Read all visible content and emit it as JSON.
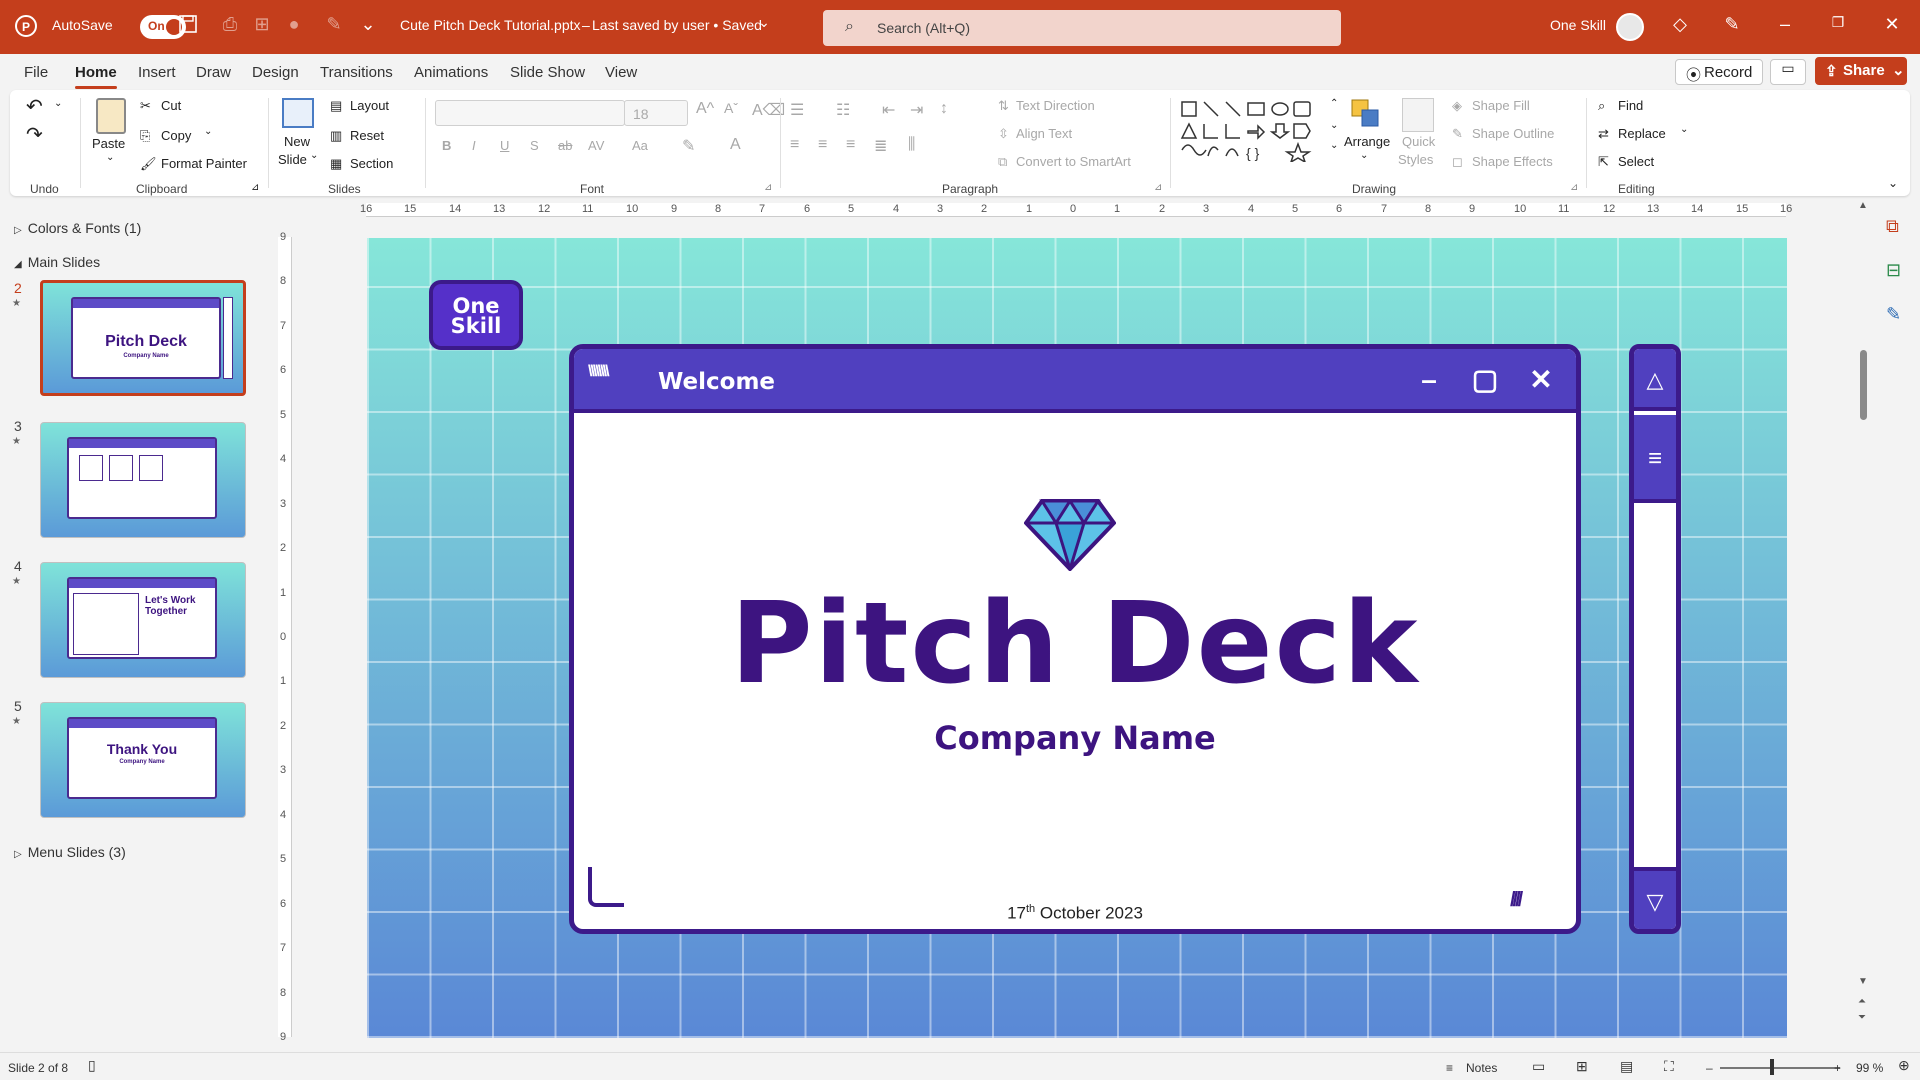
{
  "titlebar": {
    "autosave_label": "AutoSave",
    "autosave_state": "On",
    "doc_title": "Cute Pitch Deck Tutorial.pptx",
    "save_status": "Last saved by user • Saved",
    "search_placeholder": "Search (Alt+Q)",
    "account_name": "One Skill"
  },
  "menu": {
    "tabs": [
      "File",
      "Home",
      "Insert",
      "Draw",
      "Design",
      "Transitions",
      "Animations",
      "Slide Show",
      "View"
    ],
    "active_tab": "Home",
    "record_label": "Record",
    "share_label": "Share"
  },
  "ribbon": {
    "undo_group": "Undo",
    "clipboard": {
      "paste": "Paste",
      "cut": "Cut",
      "copy": "Copy",
      "format_painter": "Format Painter",
      "group": "Clipboard"
    },
    "slides": {
      "new_slide_1": "New",
      "new_slide_2": "Slide",
      "layout": "Layout",
      "reset": "Reset",
      "section": "Section",
      "group": "Slides"
    },
    "font": {
      "size": "18",
      "group": "Font"
    },
    "paragraph": {
      "text_direction": "Text Direction",
      "align_text": "Align Text",
      "smartart": "Convert to SmartArt",
      "group": "Paragraph"
    },
    "drawing": {
      "arrange": "Arrange",
      "quick_styles_1": "Quick",
      "quick_styles_2": "Styles",
      "shape_fill": "Shape Fill",
      "shape_outline": "Shape Outline",
      "shape_effects": "Shape Effects",
      "group": "Drawing"
    },
    "editing": {
      "find": "Find",
      "replace": "Replace",
      "select": "Select",
      "group": "Editing"
    }
  },
  "left_panel": {
    "section_colors": "Colors & Fonts (1)",
    "section_main": "Main Slides",
    "section_menu": "Menu Slides (3)",
    "thumbnails": [
      {
        "num": "2",
        "title": "Pitch Deck",
        "subtitle": "Company Name"
      },
      {
        "num": "3",
        "title": "",
        "subtitle": ""
      },
      {
        "num": "4",
        "title": "Let's Work Together",
        "subtitle": ""
      },
      {
        "num": "5",
        "title": "Thank You",
        "subtitle": "Company Name"
      }
    ]
  },
  "rulers": {
    "horizontal": [
      "16",
      "15",
      "14",
      "13",
      "12",
      "11",
      "10",
      "9",
      "8",
      "7",
      "6",
      "5",
      "4",
      "3",
      "2",
      "1",
      "0",
      "1",
      "2",
      "3",
      "4",
      "5",
      "6",
      "7",
      "8",
      "9",
      "10",
      "11",
      "12",
      "13",
      "14",
      "15",
      "16"
    ],
    "vertical": [
      "9",
      "8",
      "7",
      "6",
      "5",
      "4",
      "3",
      "2",
      "1",
      "0",
      "1",
      "2",
      "3",
      "4",
      "5",
      "6",
      "7",
      "8",
      "9"
    ]
  },
  "slide": {
    "logo_line1": "One",
    "logo_line2": "Skill",
    "window_title": "Welcome",
    "title": "Pitch Deck",
    "company": "Company Name",
    "date_day": "17",
    "date_sup": "th",
    "date_rest": " October 2023"
  },
  "status": {
    "slide_info": "Slide 2 of 8",
    "notes": "Notes",
    "zoom": "99 %"
  },
  "colors": {
    "accent": "#c43e1c",
    "slide_purple": "#3d1480",
    "window_bar": "#5040bf"
  }
}
